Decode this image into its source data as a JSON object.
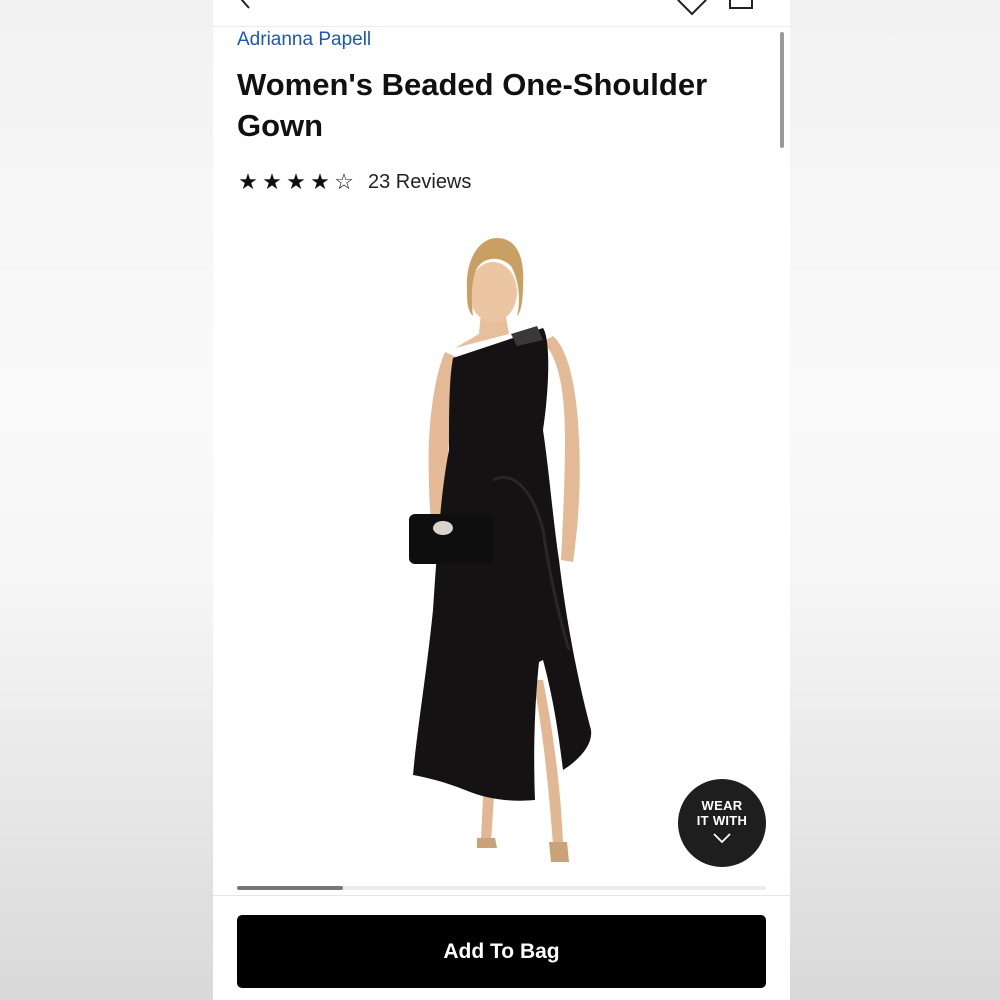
{
  "product": {
    "brand": "Adrianna Papell",
    "title": "Women's Beaded One-Shoulder Gown",
    "rating": 4,
    "rating_max": 5,
    "reviews_label": "23 Reviews"
  },
  "header": {
    "icons": [
      "back-arrow-icon",
      "heart-icon",
      "shopping-bag-icon"
    ]
  },
  "gallery": {
    "progress": 0.2,
    "wear_button": {
      "line1": "WEAR",
      "line2": "IT WITH",
      "icon": "chevron-down-icon"
    }
  },
  "actions": {
    "add_to_bag_label": "Add To Bag"
  },
  "colors": {
    "brand_link": "#1a56c4",
    "button_bg": "#000000",
    "dress": "#141212"
  }
}
